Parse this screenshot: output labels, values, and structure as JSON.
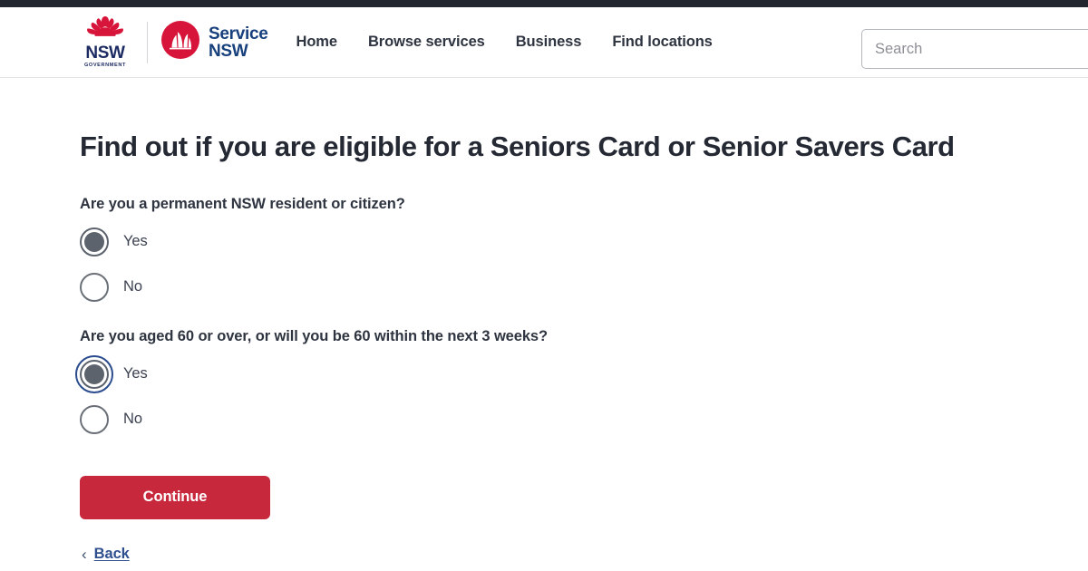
{
  "header": {
    "gov_logo": {
      "icon": "waratah-icon",
      "line1": "NSW",
      "line2": "GOVERNMENT"
    },
    "service_logo": {
      "icon": "opera-house-icon",
      "line1": "Service",
      "line2": "NSW"
    },
    "nav": [
      {
        "label": "Home",
        "name": "nav-link-home"
      },
      {
        "label": "Browse services",
        "name": "nav-link-browse-services"
      },
      {
        "label": "Business",
        "name": "nav-link-business"
      },
      {
        "label": "Find locations",
        "name": "nav-link-find-locations"
      }
    ],
    "search": {
      "placeholder": "Search",
      "value": ""
    }
  },
  "main": {
    "title": "Find out if you are eligible for a Seniors Card or Senior Savers Card",
    "questions": [
      {
        "text": "Are you a permanent NSW resident or citizen?",
        "options": [
          {
            "label": "Yes",
            "selected": true,
            "focused": false
          },
          {
            "label": "No",
            "selected": false,
            "focused": false
          }
        ]
      },
      {
        "text": "Are you aged 60 or over, or will you be 60 within the next 3 weeks?",
        "options": [
          {
            "label": "Yes",
            "selected": true,
            "focused": true
          },
          {
            "label": "No",
            "selected": false,
            "focused": false
          }
        ]
      }
    ],
    "continue_label": "Continue",
    "back": {
      "chevron": "‹",
      "label": "Back"
    }
  },
  "colors": {
    "brand_red": "#c8283c",
    "brand_navy": "#17407d",
    "top_strip": "#22262e",
    "focus_ring": "#2a4b8d",
    "radio_gray": "#5d636c",
    "link_blue": "#2f4f8f"
  }
}
